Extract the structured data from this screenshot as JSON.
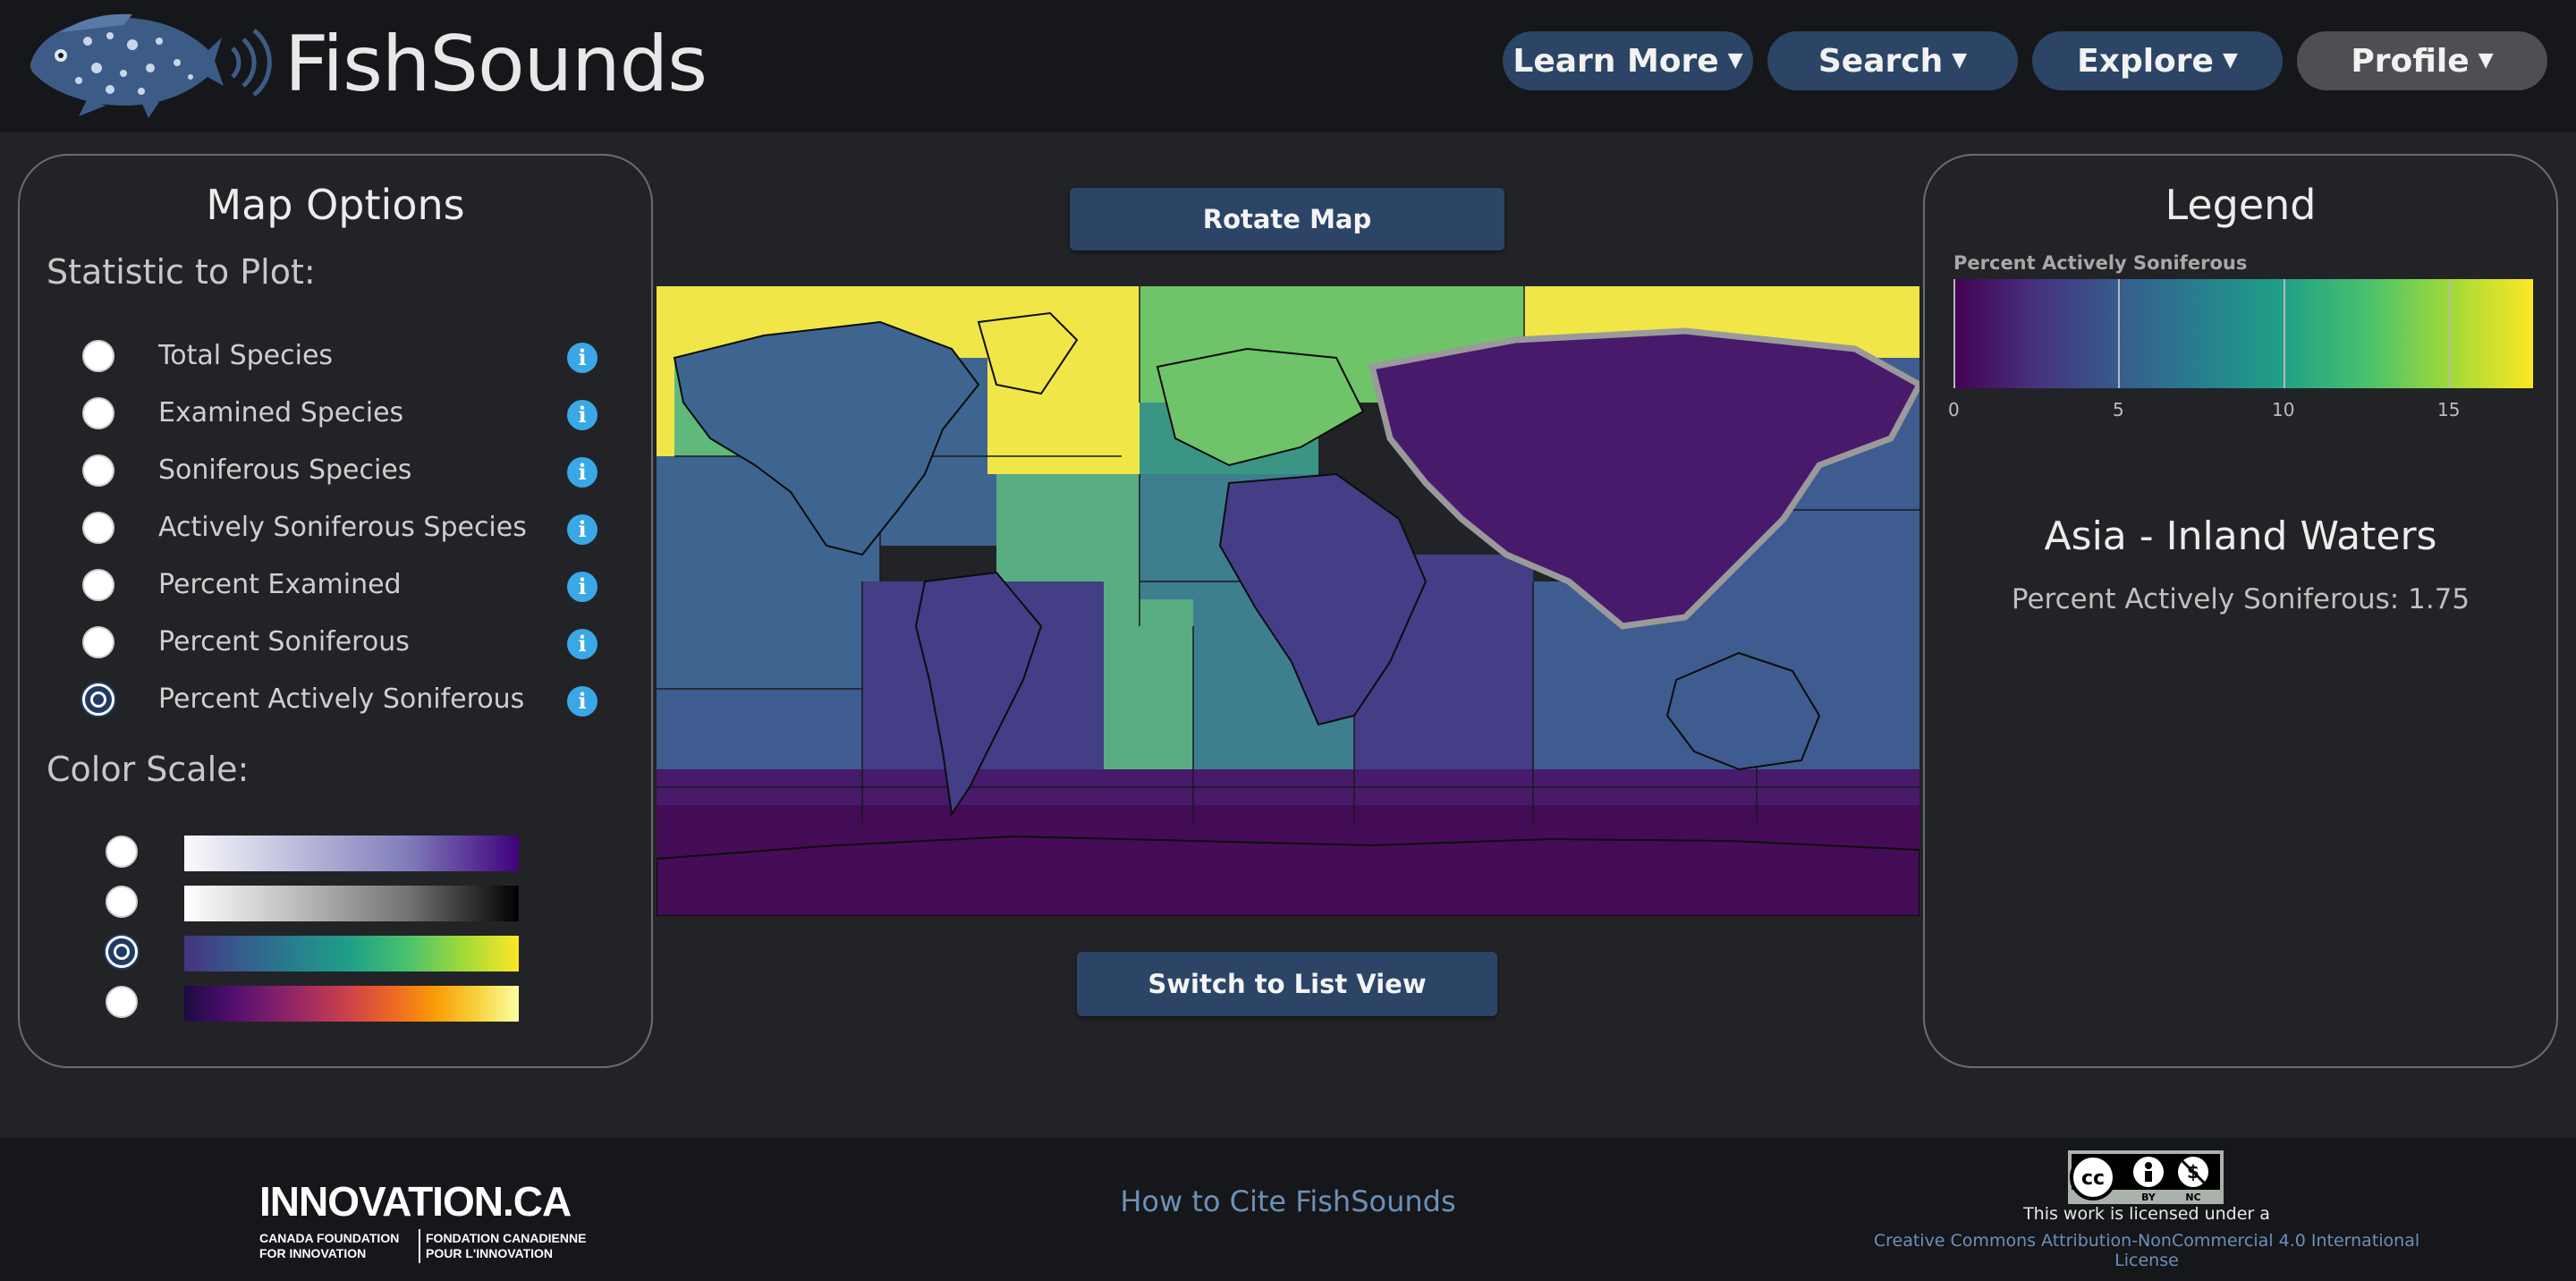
{
  "header": {
    "brand": "FishSounds",
    "nav": [
      {
        "label": "Learn More"
      },
      {
        "label": "Search"
      },
      {
        "label": "Explore"
      },
      {
        "label": "Profile"
      }
    ]
  },
  "map_options": {
    "title": "Map Options",
    "statistic_heading": "Statistic to Plot:",
    "statistics": [
      {
        "label": "Total Species",
        "selected": false
      },
      {
        "label": "Examined Species",
        "selected": false
      },
      {
        "label": "Soniferous Species",
        "selected": false
      },
      {
        "label": "Actively Soniferous Species",
        "selected": false
      },
      {
        "label": "Percent Examined",
        "selected": false
      },
      {
        "label": "Percent Soniferous",
        "selected": false
      },
      {
        "label": "Percent Actively Soniferous",
        "selected": true
      }
    ],
    "color_heading": "Color Scale:",
    "color_scales": [
      {
        "name": "purples",
        "selected": false
      },
      {
        "name": "greys",
        "selected": false
      },
      {
        "name": "viridis",
        "selected": true
      },
      {
        "name": "inferno",
        "selected": false
      }
    ]
  },
  "center": {
    "rotate_label": "Rotate Map",
    "list_view_label": "Switch to List View"
  },
  "legend": {
    "title": "Legend",
    "scale_label": "Percent Actively Soniferous",
    "ticks": [
      "0",
      "5",
      "10",
      "15"
    ],
    "range": [
      0,
      17.5
    ],
    "region_name": "Asia - Inland Waters",
    "region_stat": "Percent Actively Soniferous: 1.75"
  },
  "footer": {
    "innovation_title": "INNOVATION.CA",
    "innovation_en": "CANADA FOUNDATION\nFOR INNOVATION",
    "innovation_fr": "FONDATION CANADIENNE\nPOUR L'INNOVATION",
    "cite_link": "How to Cite FishSounds",
    "license_text": "This work is licensed under a",
    "license_link": "Creative Commons Attribution-NonCommercial 4.0 International License"
  },
  "colors": {
    "nav_bg": "#2c4566",
    "profile_bg": "#4d4f54",
    "info_icon": "#3aa7e6",
    "link": "#6c90b8"
  }
}
